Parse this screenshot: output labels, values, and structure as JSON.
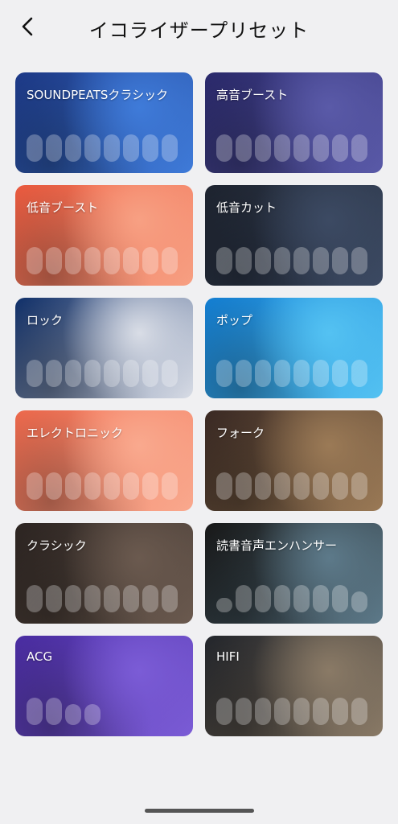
{
  "header": {
    "title": "イコライザープリセット"
  },
  "presets": [
    {
      "label": "SOUNDPEATSクラシック",
      "bg": "#1d3a8a",
      "accent": "#3f7bd9",
      "levels": [
        0.6,
        0.6,
        0.6,
        0.6,
        0.6,
        0.6,
        0.6,
        0.6
      ]
    },
    {
      "label": "高音ブースト",
      "bg": "#2b2a6e",
      "accent": "#5a5aa8",
      "levels": [
        0.6,
        0.6,
        0.6,
        0.6,
        0.6,
        0.6,
        0.6,
        0.6
      ]
    },
    {
      "label": "低音ブースト",
      "bg": "#ef5b3f",
      "accent": "#f7a083",
      "levels": [
        0.6,
        0.6,
        0.6,
        0.6,
        0.6,
        0.6,
        0.6,
        0.6
      ]
    },
    {
      "label": "低音カット",
      "bg": "#1e2430",
      "accent": "#3c4a63",
      "levels": [
        0.6,
        0.6,
        0.6,
        0.6,
        0.6,
        0.6,
        0.6,
        0.6
      ]
    },
    {
      "label": "ロック",
      "bg": "#10306b",
      "accent": "#d9dde6",
      "levels": [
        0.6,
        0.6,
        0.6,
        0.6,
        0.6,
        0.6,
        0.6,
        0.6
      ]
    },
    {
      "label": "ポップ",
      "bg": "#1380d6",
      "accent": "#54c2f2",
      "levels": [
        0.6,
        0.6,
        0.6,
        0.6,
        0.6,
        0.6,
        0.6,
        0.6
      ]
    },
    {
      "label": "エレクトロニック",
      "bg": "#f26a4d",
      "accent": "#f9a98e",
      "levels": [
        0.6,
        0.6,
        0.6,
        0.6,
        0.6,
        0.6,
        0.6,
        0.6
      ]
    },
    {
      "label": "フォーク",
      "bg": "#3b2a24",
      "accent": "#9b7a56",
      "levels": [
        0.6,
        0.6,
        0.6,
        0.6,
        0.6,
        0.6,
        0.6,
        0.6
      ]
    },
    {
      "label": "クラシック",
      "bg": "#2d2522",
      "accent": "#6b5a4f",
      "levels": [
        0.6,
        0.6,
        0.6,
        0.6,
        0.6,
        0.6,
        0.6,
        0.6
      ]
    },
    {
      "label": "読書音声エンハンサー",
      "bg": "#181818",
      "accent": "#5d7a8a",
      "levels": [
        0.2,
        0.6,
        0.6,
        0.6,
        0.6,
        0.6,
        0.6,
        0.4
      ]
    },
    {
      "label": "ACG",
      "bg": "#4b2da5",
      "accent": "#7b5cd6",
      "levels": [
        0.6,
        0.6,
        0.4,
        0.4,
        0.0,
        0.0,
        0.0,
        0.0
      ]
    },
    {
      "label": "HIFI",
      "bg": "#23262c",
      "accent": "#8a7a66",
      "levels": [
        0.6,
        0.6,
        0.6,
        0.6,
        0.6,
        0.6,
        0.6,
        0.6
      ]
    }
  ]
}
